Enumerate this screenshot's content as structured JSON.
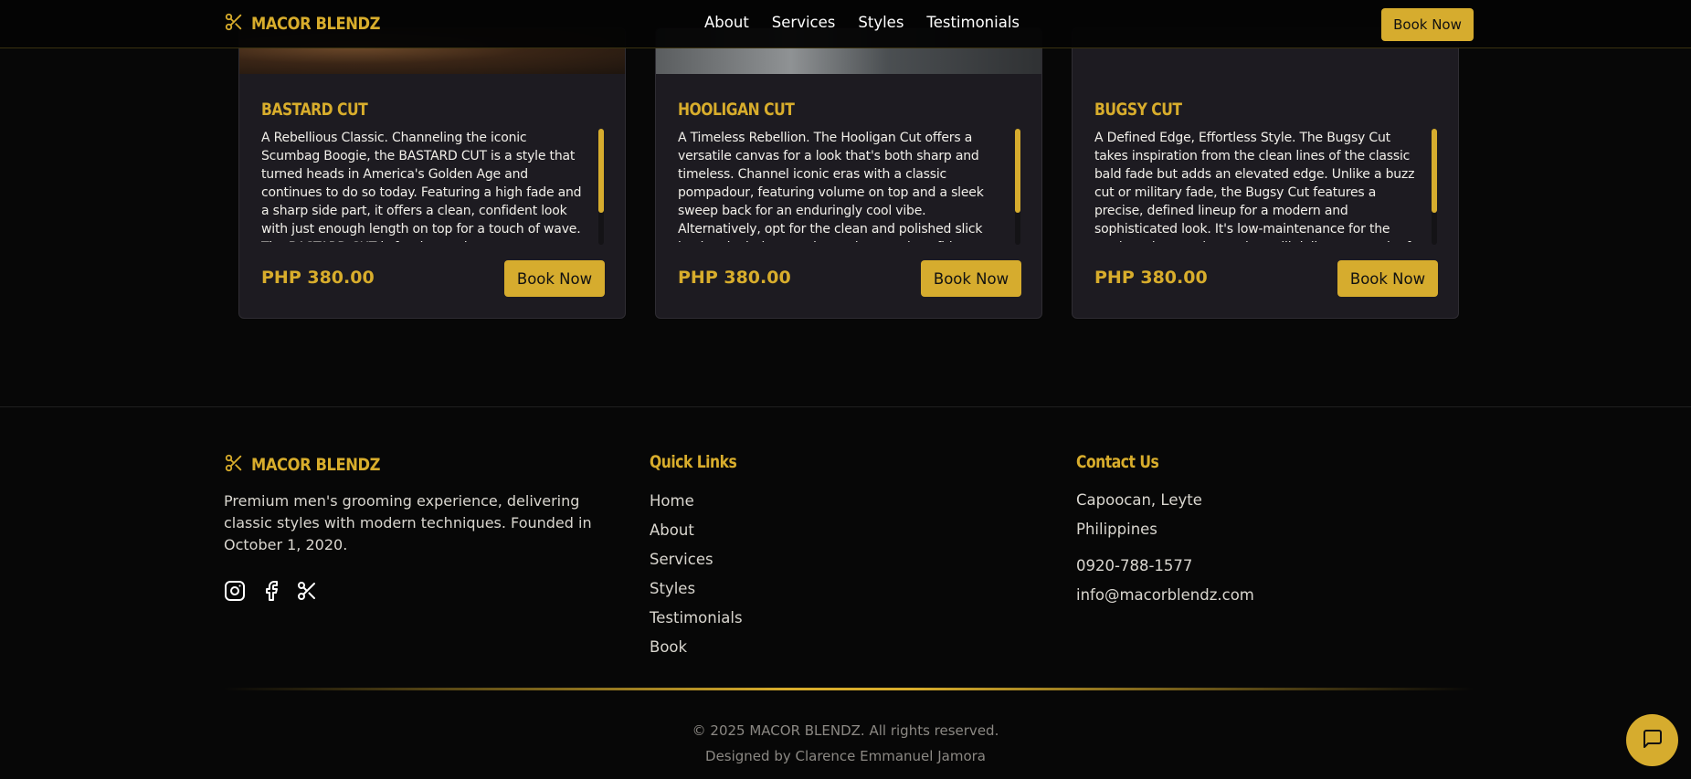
{
  "header": {
    "logo_text": "MACOR BLENDZ",
    "nav": [
      "About",
      "Services",
      "Styles",
      "Testimonials"
    ],
    "book_label": "Book Now"
  },
  "cards": [
    {
      "title": "BASTARD CUT",
      "description": "A Rebellious Classic. Channeling the iconic Scumbag Boogie, the BASTARD CUT is a style that turned heads in America's Golden Age and continues to do so today. Featuring a high fade and a sharp side part, it offers a clean, confident look with just enough length on top for a touch of wave. The BASTARD CUT is for the modern",
      "price": "PHP 380.00",
      "book_label": "Book Now"
    },
    {
      "title": "HOOLIGAN CUT",
      "description": "A Timeless Rebellion. The Hooligan Cut offers a versatile canvas for a look that's both sharp and timeless. Channel iconic eras with a classic pompadour, featuring volume on top and a sleek sweep back for an enduringly cool vibe. Alternatively, opt for the clean and polished slick back, a look that exudes understated confidence.",
      "price": "PHP 380.00",
      "book_label": "Book Now"
    },
    {
      "title": "BUGSY CUT",
      "description": "A Defined Edge, Effortless Style. The Bugsy Cut takes inspiration from the clean lines of the classic bald fade but adds an elevated edge. Unlike a buzz cut or military fade, the Bugsy Cut features a precise, defined lineup for a modern and sophisticated look. It's low-maintenance for the modern-day gentleman but still delivers a touch of",
      "price": "PHP 380.00",
      "book_label": "Book Now"
    }
  ],
  "footer": {
    "logo_text": "MACOR BLENDZ",
    "description": "Premium men's grooming experience, delivering classic styles with modern techniques. Founded in October 1, 2020.",
    "social_icons": [
      "instagram-icon",
      "facebook-icon",
      "scissors-icon"
    ],
    "quick_links_title": "Quick Links",
    "quick_links": [
      "Home",
      "About",
      "Services",
      "Styles",
      "Testimonials",
      "Book"
    ],
    "contact_title": "Contact Us",
    "address_line1": "Capoocan, Leyte",
    "address_line2": "Philippines",
    "phone": "0920-788-1577",
    "email": "info@macorblendz.com",
    "copyright": "© 2025 MACOR BLENDZ. All rights reserved.",
    "designer": "Designed by Clarence Emmanuel Jamora"
  },
  "colors": {
    "accent": "#d6ac2e",
    "background": "#070707",
    "card": "#1d1b21"
  }
}
